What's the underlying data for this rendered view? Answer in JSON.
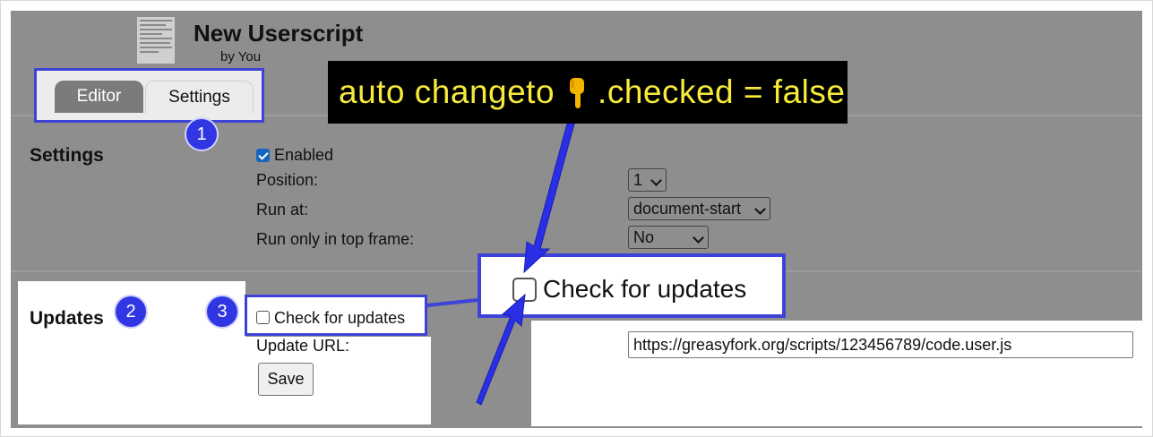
{
  "header": {
    "title": "New Userscript",
    "byline": "by You"
  },
  "tabs": [
    {
      "label": "Editor",
      "active": true
    },
    {
      "label": "Settings",
      "active": false
    }
  ],
  "annotation": {
    "before_icon": "auto changeto",
    "icon": "backhand-index-pointing-down-icon",
    "after_icon": ".checked = false"
  },
  "badges": [
    "1",
    "2",
    "3"
  ],
  "settings": {
    "title": "Settings",
    "enabled_label": "Enabled",
    "enabled_checked": true,
    "position_label": "Position:",
    "position_value": "1",
    "run_at_label": "Run at:",
    "run_at_value": "document-start",
    "top_frame_label": "Run only in top frame:",
    "top_frame_value": "No"
  },
  "updates": {
    "title": "Updates",
    "check_label": "Check for updates",
    "check_checked": false,
    "url_label": "Update URL:",
    "url_value": "https://greasyfork.org/scripts/123456789/code.user.js",
    "save_label": "Save"
  },
  "zoom": {
    "check_label": "Check for updates",
    "checked": false
  },
  "colors": {
    "annotation_blue": "#3e43d8",
    "annotation_text": "#f6ea3a",
    "checkbox_blue": "#1565c0",
    "background": "#8e8e8e"
  }
}
